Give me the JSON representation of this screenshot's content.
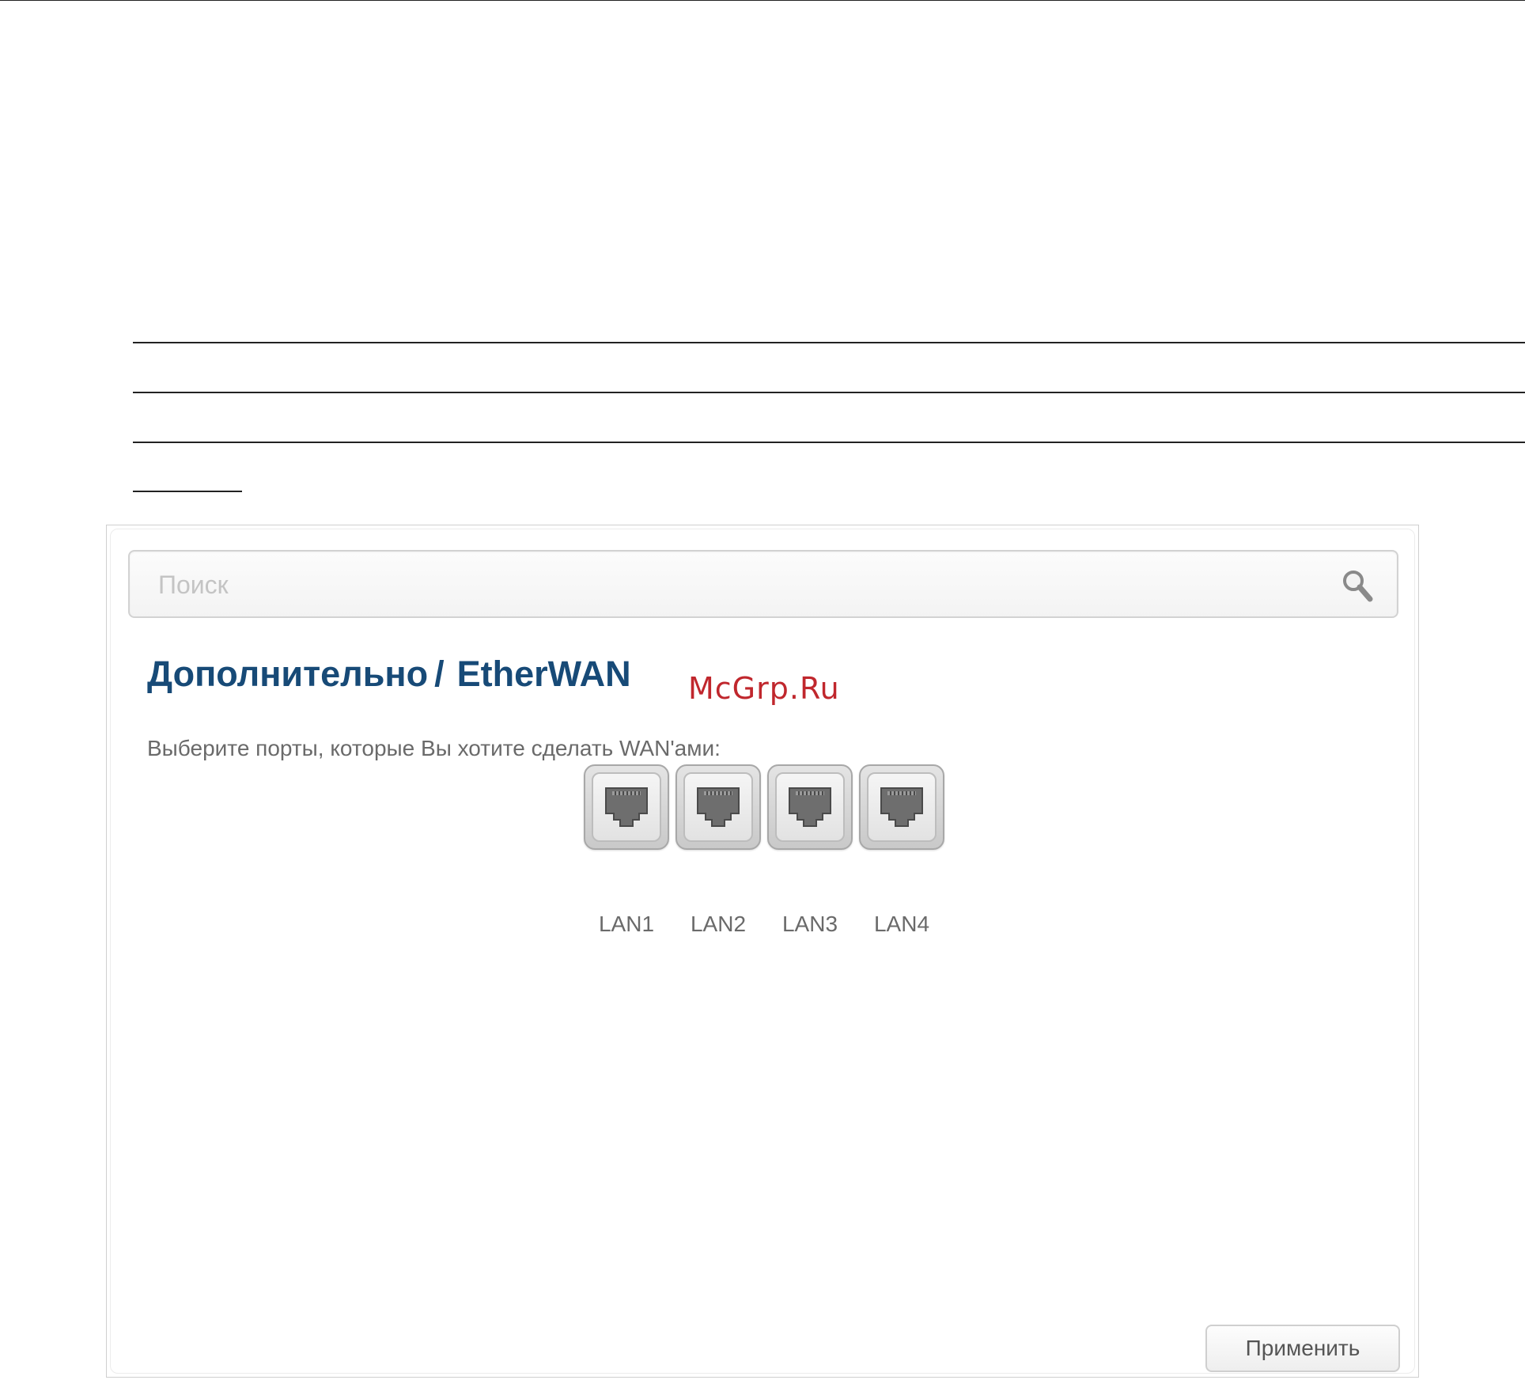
{
  "search": {
    "placeholder": "Поиск",
    "icon": "search-icon"
  },
  "page": {
    "breadcrumb_section": "Дополнительно",
    "breadcrumb_separator": "/",
    "breadcrumb_page": "EtherWAN",
    "instruction": "Выберите порты, которые Вы хотите сделать WAN'ами:"
  },
  "watermark": "McGrp.Ru",
  "ports": [
    {
      "label": "LAN1",
      "icon": "ethernet-port-icon"
    },
    {
      "label": "LAN2",
      "icon": "ethernet-port-icon"
    },
    {
      "label": "LAN3",
      "icon": "ethernet-port-icon"
    },
    {
      "label": "LAN4",
      "icon": "ethernet-port-icon"
    }
  ],
  "actions": {
    "apply_label": "Применить"
  },
  "colors": {
    "title": "#174a77",
    "watermark": "#c0272d",
    "text": "#6a6a6a"
  }
}
